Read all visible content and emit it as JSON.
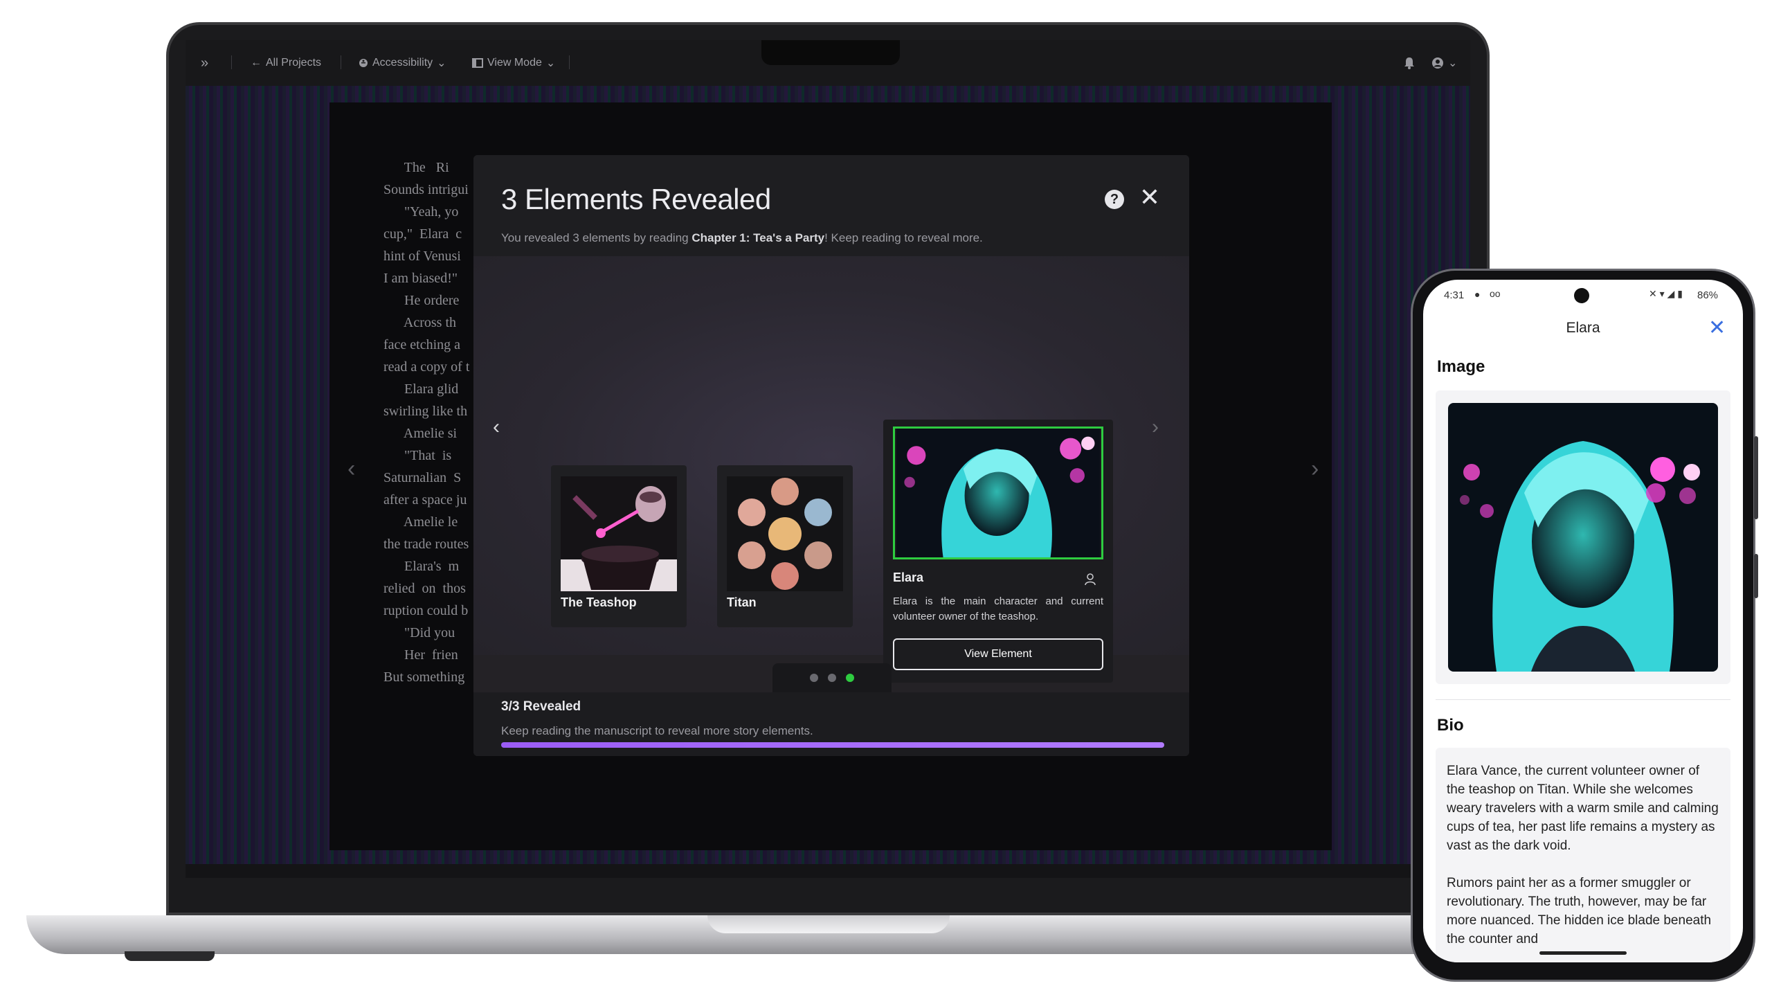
{
  "laptop": {
    "topbar": {
      "expand_icon": "double-chevron-right-icon",
      "back_label": "All Projects",
      "accessibility_label": "Accessibility",
      "view_mode_label": "View Mode"
    },
    "manuscript_lines": [
      "      The   Ri",
      "Sounds intrigui",
      "      \"Yeah, yo",
      "cup,\"  Elara  c",
      "hint of Venusi",
      "I am biased!\"",
      "      He ordere",
      "      Across th",
      "face etching a",
      "read a copy of t",
      "      Elara glid",
      "swirling like th",
      "      Amelie si",
      "      \"That  is",
      "Saturnalian  S",
      "after a space ju",
      "      Amelie le",
      "the trade routes",
      "      Elara's  m",
      "relied  on  thos",
      "ruption could b",
      "      \"Did you",
      "      Her  frien",
      "But something"
    ],
    "modal": {
      "title": "3 Elements Revealed",
      "subtitle_prefix": "You revealed 3 elements by reading ",
      "subtitle_chapter": "Chapter 1: Tea's a Party",
      "subtitle_suffix": "! Keep reading to reveal more.",
      "help_label": "?",
      "close_label": "✕",
      "cards": [
        {
          "label": "The Teashop",
          "icon": "teapot-image"
        },
        {
          "label": "Titan",
          "icon": "planets-image"
        },
        {
          "label": "Elara",
          "icon": "person-icon",
          "description": "Elara is the main character and current volunteer owner of the teashop.",
          "button": "View Element"
        }
      ],
      "dots_total": 3,
      "dots_active": 2,
      "revealed_title": "3/3 Revealed",
      "revealed_sub": "Keep reading the manuscript to reveal more story elements.",
      "progress": 1.0,
      "colors": {
        "accent_green": "#2ecc40",
        "progress_purple": "#9b5cf5"
      }
    }
  },
  "phone": {
    "status": {
      "time": "4:31",
      "battery": "86%"
    },
    "title": "Elara",
    "close_label": "✕",
    "image_heading": "Image",
    "bio_heading": "Bio",
    "bio_p1": " Elara Vance, the current volunteer owner of the teashop on Titan. While she welcomes weary travelers with a warm smile and calming cups of tea, her past life remains a mystery as vast as the dark void.",
    "bio_p2": "Rumors paint her as a former smuggler or revolutionary. The truth, however, may be far more nuanced. The hidden ice blade beneath the counter and"
  }
}
